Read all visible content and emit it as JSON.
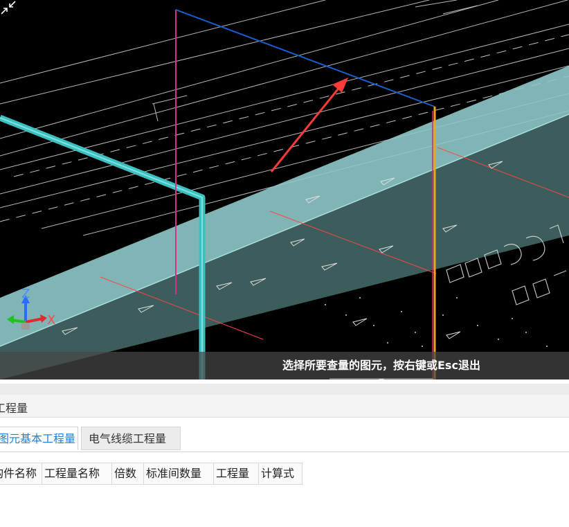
{
  "viewport": {
    "axes": {
      "z_label": "Z",
      "x_label": "X"
    },
    "hint": {
      "text": "选择所要查量的图元，按右键或Esc退出",
      "icon": "select-cursor-icon"
    }
  },
  "panel": {
    "title": "工程量",
    "tabs": [
      {
        "label": "图元基本工程量",
        "active": true
      },
      {
        "label": "电气线缆工程量",
        "active": false
      }
    ],
    "table": {
      "columns": [
        "构件名称",
        "工程量名称",
        "倍数",
        "标准间数量",
        "工程量",
        "计算式"
      ]
    }
  },
  "colors": {
    "viewport_bg": "#000000",
    "slab_fill": "#8fc9c9",
    "pipe": "#3bbfbf",
    "frame_blue": "#1a5fd0",
    "frame_magenta": "#d0338a",
    "frame_orange": "#f2a21e",
    "arrow_red": "#ff3b3b",
    "tab_active_text": "#1f7fd6"
  }
}
